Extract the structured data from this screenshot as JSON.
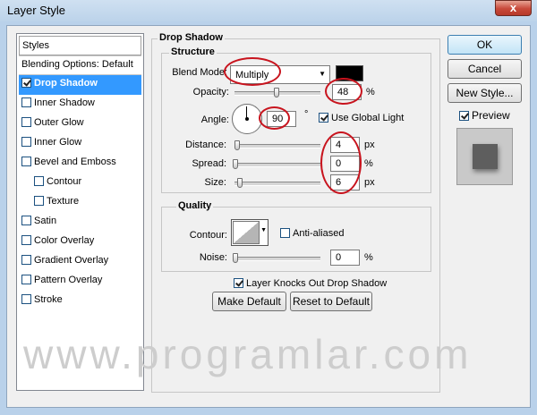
{
  "window": {
    "title": "Layer Style",
    "close_label": "x"
  },
  "styles_panel": {
    "header": "Styles",
    "items": [
      {
        "label": "Blending Options: Default",
        "checkbox": false,
        "checked": false,
        "selected": false,
        "indent": false
      },
      {
        "label": "Drop Shadow",
        "checkbox": true,
        "checked": true,
        "selected": true,
        "indent": false
      },
      {
        "label": "Inner Shadow",
        "checkbox": true,
        "checked": false,
        "selected": false,
        "indent": false
      },
      {
        "label": "Outer Glow",
        "checkbox": true,
        "checked": false,
        "selected": false,
        "indent": false
      },
      {
        "label": "Inner Glow",
        "checkbox": true,
        "checked": false,
        "selected": false,
        "indent": false
      },
      {
        "label": "Bevel and Emboss",
        "checkbox": true,
        "checked": false,
        "selected": false,
        "indent": false
      },
      {
        "label": "Contour",
        "checkbox": true,
        "checked": false,
        "selected": false,
        "indent": true
      },
      {
        "label": "Texture",
        "checkbox": true,
        "checked": false,
        "selected": false,
        "indent": true
      },
      {
        "label": "Satin",
        "checkbox": true,
        "checked": false,
        "selected": false,
        "indent": false
      },
      {
        "label": "Color Overlay",
        "checkbox": true,
        "checked": false,
        "selected": false,
        "indent": false
      },
      {
        "label": "Gradient Overlay",
        "checkbox": true,
        "checked": false,
        "selected": false,
        "indent": false
      },
      {
        "label": "Pattern Overlay",
        "checkbox": true,
        "checked": false,
        "selected": false,
        "indent": false
      },
      {
        "label": "Stroke",
        "checkbox": true,
        "checked": false,
        "selected": false,
        "indent": false
      }
    ]
  },
  "drop_shadow": {
    "title": "Drop Shadow",
    "structure": {
      "title": "Structure",
      "blend_mode_label": "Blend Mode:",
      "blend_mode_value": "Multiply",
      "shadow_color": "#000000",
      "opacity_label": "Opacity:",
      "opacity_value": "48",
      "opacity_unit": "%",
      "angle_label": "Angle:",
      "angle_value": "90",
      "angle_unit": "°",
      "use_global_light_label": "Use Global Light",
      "use_global_light_checked": true,
      "distance_label": "Distance:",
      "distance_value": "4",
      "distance_unit": "px",
      "spread_label": "Spread:",
      "spread_value": "0",
      "spread_unit": "%",
      "size_label": "Size:",
      "size_value": "6",
      "size_unit": "px"
    },
    "quality": {
      "title": "Quality",
      "contour_label": "Contour:",
      "anti_aliased_label": "Anti-aliased",
      "anti_aliased_checked": false,
      "noise_label": "Noise:",
      "noise_value": "0",
      "noise_unit": "%"
    },
    "knocks_out_label": "Layer Knocks Out Drop Shadow",
    "knocks_out_checked": true,
    "make_default_label": "Make Default",
    "reset_default_label": "Reset to Default"
  },
  "actions": {
    "ok_label": "OK",
    "cancel_label": "Cancel",
    "new_style_label": "New Style...",
    "preview_label": "Preview",
    "preview_checked": true
  },
  "watermark": "www.programlar.com",
  "colors": {
    "selection": "#3399ff",
    "annotation_ring": "#c8141e",
    "preview_swatch": "#5e5e5e"
  }
}
